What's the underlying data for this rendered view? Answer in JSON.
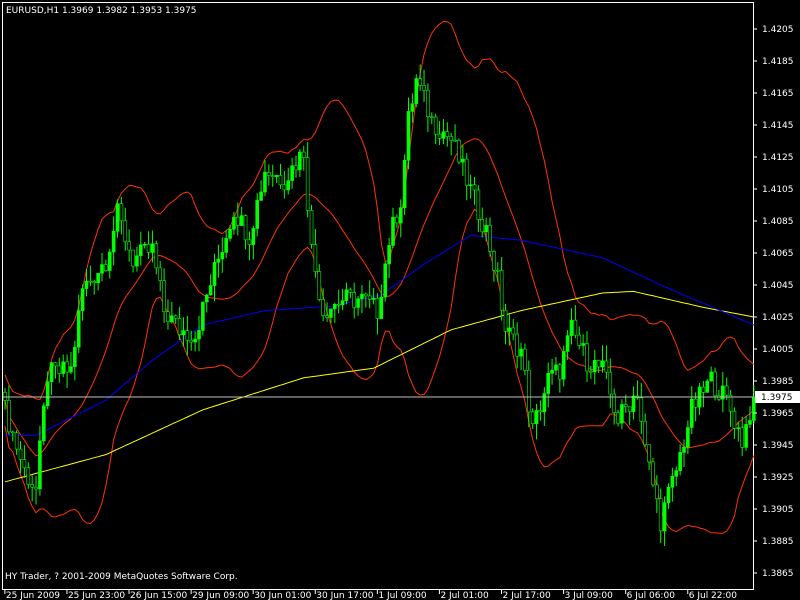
{
  "chart_data": {
    "type": "candlestick",
    "symbol_header": "EURUSD,H1  1.3969 1.3982 1.3953 1.3975",
    "footer": "HY Trader, ? 2001-2009 MetaQuotes Software Corp.",
    "current_price": "1.3975",
    "ylim": [
      1.3865,
      1.4205
    ],
    "y_ticks": [
      "1.4205",
      "1.4185",
      "1.4165",
      "1.4145",
      "1.4125",
      "1.4105",
      "1.4085",
      "1.4065",
      "1.4045",
      "1.4025",
      "1.4005",
      "1.3985",
      "1.3965",
      "1.3945",
      "1.3925",
      "1.3905",
      "1.3885",
      "1.3865"
    ],
    "bar_count": 194,
    "x_ticks": [
      {
        "bar": 1,
        "label": "25 Jun 2009"
      },
      {
        "bar": 17,
        "label": "25 Jun 23:00"
      },
      {
        "bar": 33,
        "label": "26 Jun 15:00"
      },
      {
        "bar": 49,
        "label": "29 Jun 09:00"
      },
      {
        "bar": 65,
        "label": "30 Jun 01:00"
      },
      {
        "bar": 81,
        "label": "30 Jun 17:00"
      },
      {
        "bar": 97,
        "label": "1 Jul 09:00"
      },
      {
        "bar": 113,
        "label": "2 Jul 01:00"
      },
      {
        "bar": 129,
        "label": "2 Jul 17:00"
      },
      {
        "bar": 145,
        "label": "3 Jul 09:00"
      },
      {
        "bar": 161,
        "label": "6 Jul 06:00"
      },
      {
        "bar": 177,
        "label": "6 Jul 22:00"
      }
    ],
    "close_waypoints": [
      [
        0,
        1.3967
      ],
      [
        5,
        1.3929
      ],
      [
        8,
        1.3917
      ],
      [
        11,
        1.3989
      ],
      [
        17,
        1.3992
      ],
      [
        20,
        1.4042
      ],
      [
        26,
        1.4061
      ],
      [
        29,
        1.4089
      ],
      [
        33,
        1.4061
      ],
      [
        38,
        1.4067
      ],
      [
        41,
        1.4029
      ],
      [
        45,
        1.4017
      ],
      [
        49,
        1.4014
      ],
      [
        54,
        1.4054
      ],
      [
        59,
        1.4092
      ],
      [
        63,
        1.4076
      ],
      [
        67,
        1.4117
      ],
      [
        72,
        1.4111
      ],
      [
        77,
        1.4129
      ],
      [
        79,
        1.4067
      ],
      [
        82,
        1.4029
      ],
      [
        87,
        1.4036
      ],
      [
        92,
        1.4036
      ],
      [
        96,
        1.4029
      ],
      [
        99,
        1.4073
      ],
      [
        102,
        1.4098
      ],
      [
        104,
        1.4148
      ],
      [
        106,
        1.4173
      ],
      [
        110,
        1.4148
      ],
      [
        115,
        1.4136
      ],
      [
        120,
        1.4104
      ],
      [
        124,
        1.4079
      ],
      [
        127,
        1.4048
      ],
      [
        129,
        1.4017
      ],
      [
        133,
        1.4004
      ],
      [
        136,
        1.3954
      ],
      [
        140,
        1.3986
      ],
      [
        143,
        1.3992
      ],
      [
        146,
        1.4017
      ],
      [
        150,
        1.3998
      ],
      [
        154,
        1.3992
      ],
      [
        158,
        1.3961
      ],
      [
        163,
        1.3979
      ],
      [
        165,
        1.3942
      ],
      [
        169,
        1.3898
      ],
      [
        173,
        1.3929
      ],
      [
        177,
        1.3967
      ],
      [
        182,
        1.3986
      ],
      [
        186,
        1.3973
      ],
      [
        190,
        1.3948
      ],
      [
        193,
        1.3975
      ]
    ],
    "ma_slow_waypoints": [
      [
        0,
        1.3922
      ],
      [
        26,
        1.3939
      ],
      [
        51,
        1.3967
      ],
      [
        77,
        1.3987
      ],
      [
        95,
        1.3993
      ],
      [
        115,
        1.4017
      ],
      [
        133,
        1.4029
      ],
      [
        154,
        1.404
      ],
      [
        162,
        1.4041
      ],
      [
        180,
        1.4031
      ],
      [
        193,
        1.4025
      ]
    ],
    "ma_fast_waypoints": [
      [
        8,
        1.3951
      ],
      [
        26,
        1.3973
      ],
      [
        38,
        1.3998
      ],
      [
        51,
        1.402
      ],
      [
        67,
        1.4029
      ],
      [
        85,
        1.4032
      ],
      [
        97,
        1.4039
      ],
      [
        108,
        1.4058
      ],
      [
        120,
        1.4076
      ],
      [
        133,
        1.4073
      ],
      [
        154,
        1.4062
      ],
      [
        169,
        1.4045
      ],
      [
        193,
        1.402
      ]
    ],
    "bollinger": {
      "period": 20,
      "deviation": 2
    },
    "colors": {
      "bg": "#000000",
      "candle": "#00ff00",
      "bands": "#ff3300",
      "ma_slow": "#ffff00",
      "ma_fast": "#0000ff",
      "grid_line": "#c0c0c0",
      "axis": "#ffffff"
    }
  }
}
